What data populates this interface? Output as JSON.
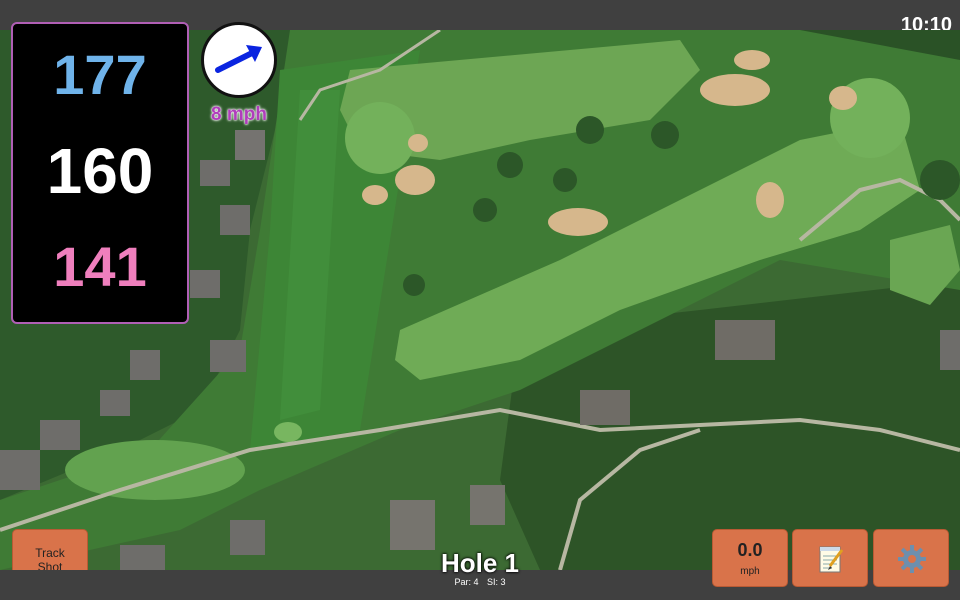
{
  "status": {
    "time": "10:10"
  },
  "distances": {
    "back": "177",
    "middle": "160",
    "front": "141"
  },
  "wind": {
    "speed_label": "8 mph",
    "icon": "wind-direction-arrow-icon"
  },
  "hole": {
    "title": "Hole 1",
    "par": "Par: 4",
    "stroke_index": "SI: 3"
  },
  "buttons": {
    "track_shot_line1": "Track",
    "track_shot_line2": "Shot",
    "speed_value": "0.0",
    "speed_unit": "mph",
    "notes_icon": "notepad-icon",
    "settings_icon": "gear-icon"
  },
  "colors": {
    "back_distance": "#6fb3ea",
    "middle_distance": "#ffffff",
    "front_distance": "#ef7fbd",
    "panel_border": "#b05fb5",
    "button_bg": "#d9734a",
    "wind_text": "#b03dbb"
  }
}
